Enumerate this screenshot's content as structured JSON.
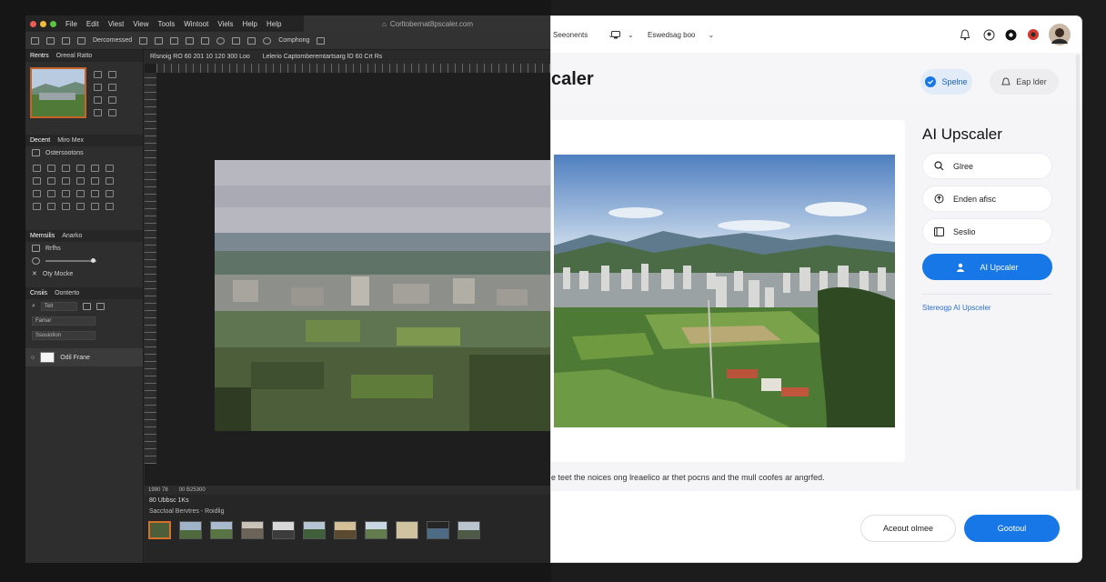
{
  "editor": {
    "menu": [
      "File",
      "Edit",
      "Viest",
      "View",
      "Tools",
      "Wintoot",
      "Viels",
      "Help",
      "Help"
    ],
    "window_title": "Corltobernat8pscaler.com",
    "options_bar": {
      "mode_label": "Dercomessed",
      "comp_label": "Comphong"
    },
    "panels": {
      "nav_tabs": [
        "Rentrs",
        "Oreeal Ratto"
      ],
      "adjust_tabs": [
        "Decent",
        "Miro Mex"
      ],
      "adjust_header": "Ostersootons",
      "props_tabs": [
        "Memsilis",
        "Anarko"
      ],
      "props_rows": [
        "Rrfhs",
        "Oty Mocke"
      ],
      "layers_tabs": [
        "Cnsiis",
        "Oonterto"
      ],
      "layer_fields": [
        "Telt",
        "Famar",
        "Ssouiotion"
      ],
      "layer_name": "Odil Frane"
    },
    "doc_tab": [
      "Rlsnoig RO 60 201 10 120 300 Loo",
      "Lelerio Captomberemtartsarg lO 60 Crt Rs"
    ],
    "status": [
      "1990 78",
      "00 B25300"
    ],
    "filmstrip": {
      "title": "80 Ubbsc 1Ks",
      "subtitle": "Sacctoal Bervtres - Roidlig"
    }
  },
  "app": {
    "nav": {
      "item1": "Seeonents",
      "item3": "Eswedsag boo"
    },
    "page_title": "caler",
    "header_buttons": {
      "primary": "Spelne",
      "secondary": "Eap lder"
    },
    "side": {
      "title": "AI Upscaler",
      "buttons": [
        "Glree",
        "Enden afisc",
        "Seslio"
      ],
      "primary": "AI Upcaler",
      "link": "Stereogp AI Upsceler"
    },
    "caption": "e teet the noices ong lreaelico ar thet pocns and the mull coofes ar angrfed.",
    "footer": {
      "secondary": "Aceout olmee",
      "primary": "Gootoul"
    }
  },
  "colors": {
    "accent": "#1777e6",
    "selection": "#c8632a",
    "editor_bg": "#2b2b2b"
  }
}
